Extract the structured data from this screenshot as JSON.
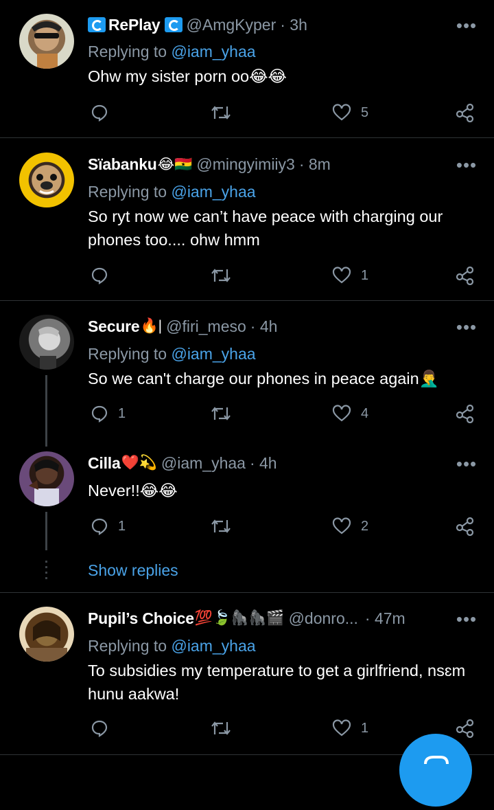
{
  "colors": {
    "background": "#000000",
    "accent": "#4aa3e8",
    "muted": "#8b98a5",
    "separator": "#2f3336"
  },
  "tweets": [
    {
      "name": "RePlay",
      "name_prefix_icon": "retweet-badge-icon",
      "name_emoji": "",
      "handle": "@AmgKyper",
      "time": "· 3h",
      "replying_label": "Replying to ",
      "replying_to": "@iam_yhaa",
      "text": "Ohw my sister porn oo😂😂",
      "replies": "",
      "likes": "5"
    },
    {
      "name": "Sïabanku",
      "name_emoji": "😂🇬🇭",
      "handle": "@mingyimiiy3",
      "time": "· 8m",
      "replying_label": "Replying to ",
      "replying_to": "@iam_yhaa",
      "text": "So ryt now we can’t have peace with charging our phones too.... ohw hmm",
      "replies": "",
      "likes": "1"
    },
    {
      "name": "Secure",
      "name_emoji": "🔥|",
      "handle": "@firi_meso",
      "time": "· 4h",
      "replying_label": "Replying to ",
      "replying_to": "@iam_yhaa",
      "text": "So we can't charge our phones in peace again🤦‍♂️",
      "replies": "1",
      "likes": "4"
    },
    {
      "name": "Cilla",
      "name_emoji": "❤️💫",
      "handle": "@iam_yhaa",
      "time": "· 4h",
      "text": "Never!!😂😂",
      "replies": "1",
      "likes": "2"
    },
    {
      "name": "Pupil’s Choice",
      "name_emoji": "💯🍃🦍🦍🎬",
      "handle": "@donro...",
      "time": "· 47m",
      "replying_label": "Replying to ",
      "replying_to": "@iam_yhaa",
      "text": "To subsidies my temperature to get a girlfriend, nsɛm hunu aakwa!",
      "replies": "",
      "likes": "1"
    }
  ],
  "show_replies_label": "Show replies",
  "more_label": "•••"
}
